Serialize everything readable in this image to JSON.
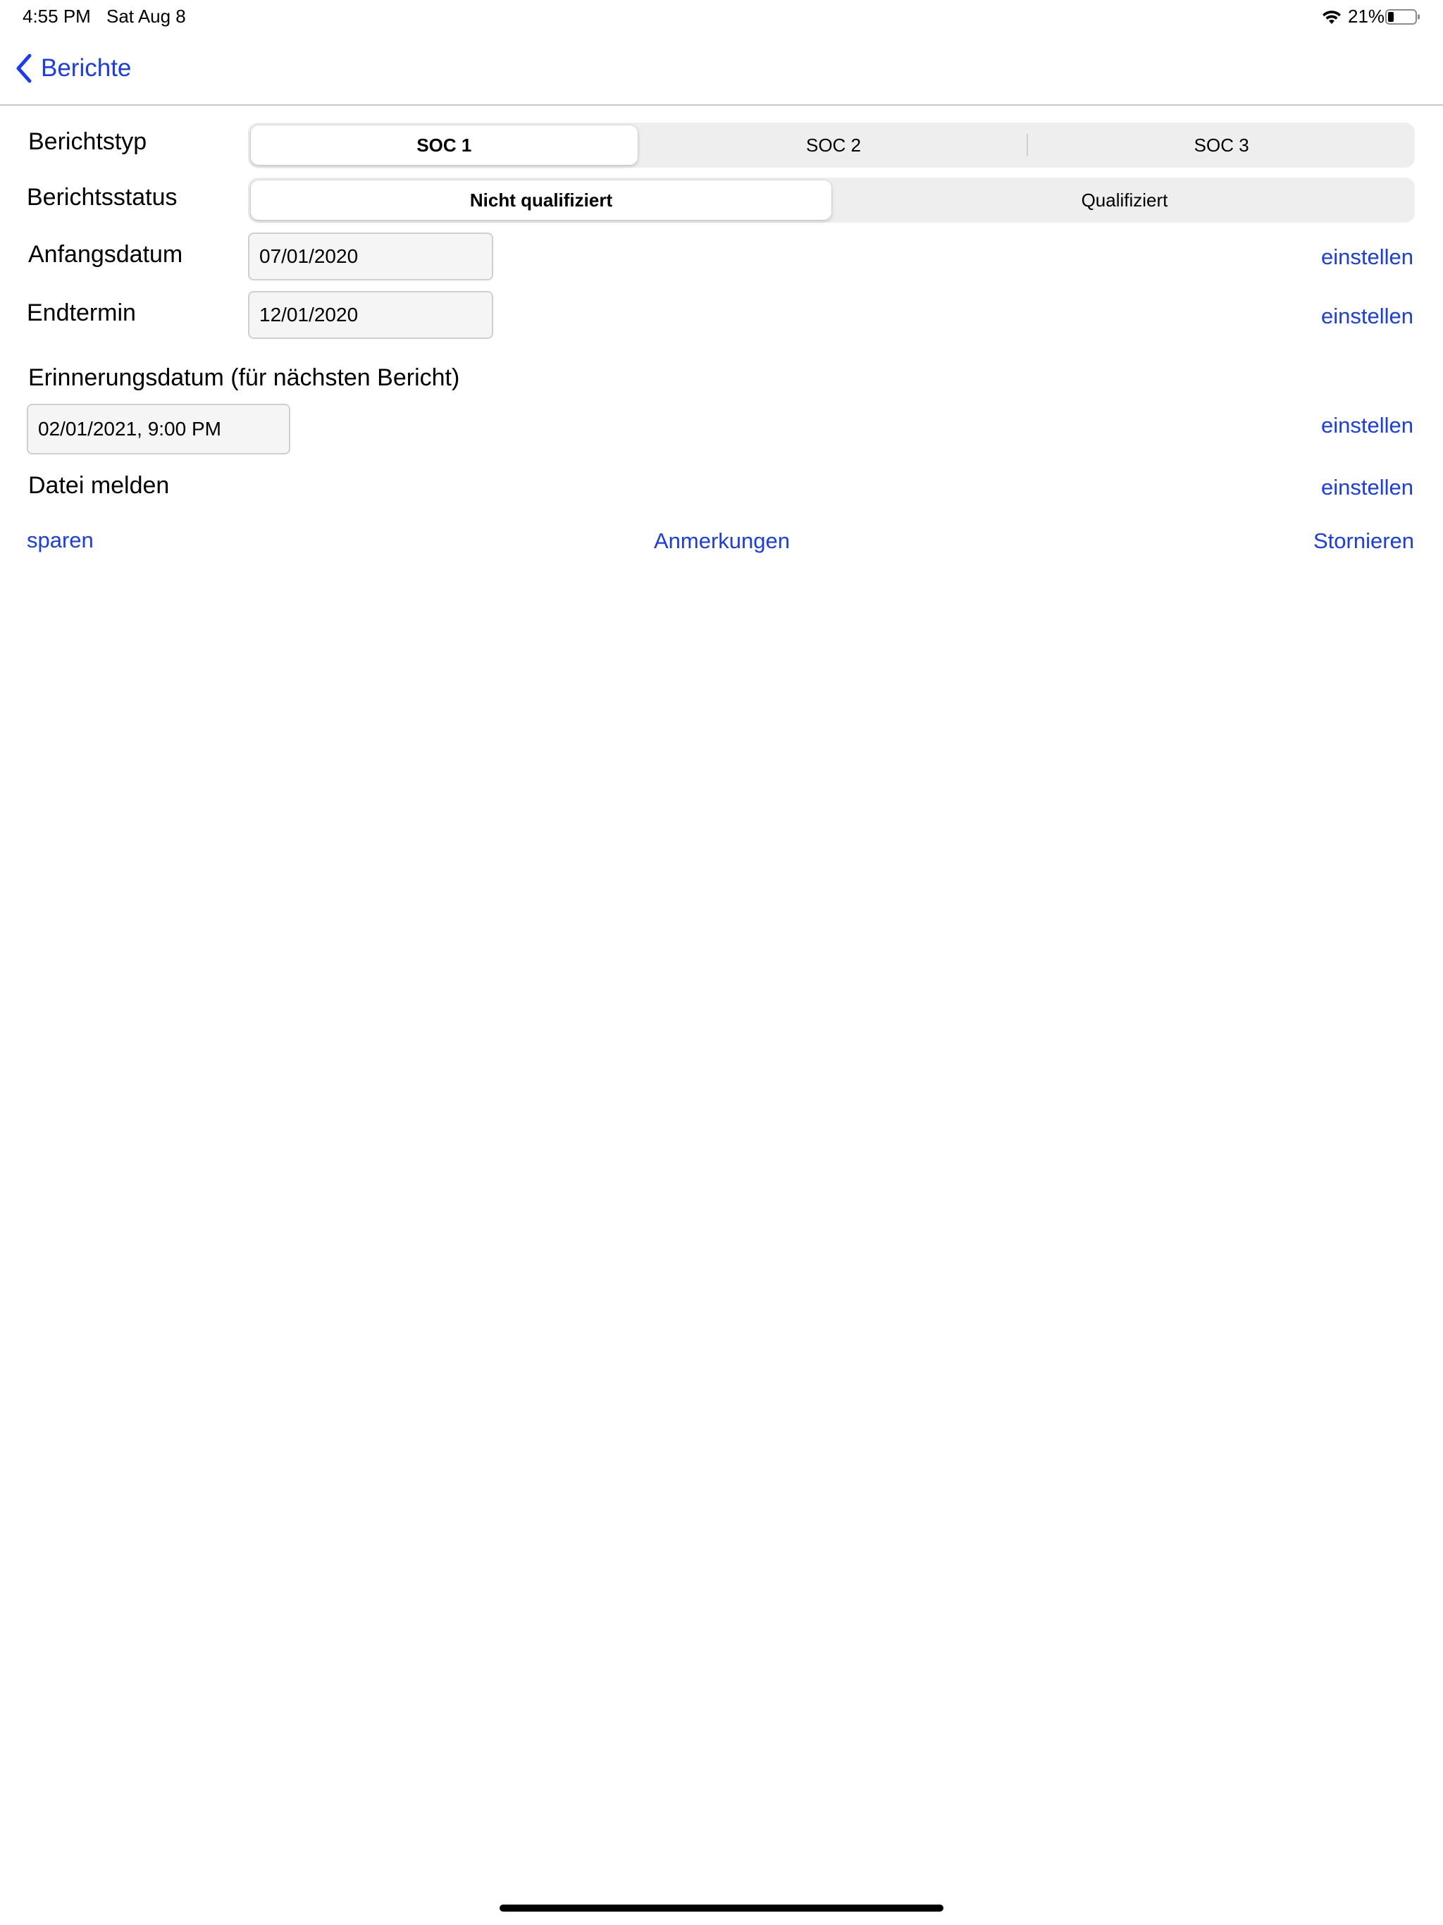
{
  "status_bar": {
    "time": "4:55 PM",
    "date": "Sat Aug 8",
    "battery_percent": "21%",
    "battery_level": 0.21,
    "wifi_icon": "wifi-icon",
    "battery_icon": "battery-icon"
  },
  "nav": {
    "back_label": "Berichte",
    "back_icon": "chevron-left-icon"
  },
  "form": {
    "report_type": {
      "label": "Berichtstyp",
      "options": [
        "SOC 1",
        "SOC 2",
        "SOC 3"
      ],
      "selected": "SOC 1"
    },
    "report_status": {
      "label": "Berichtsstatus",
      "options": [
        "Nicht qualifiziert",
        "Qualifiziert"
      ],
      "selected": "Nicht qualifiziert"
    },
    "start_date": {
      "label": "Anfangsdatum",
      "value": "07/01/2020",
      "action": "einstellen"
    },
    "end_date": {
      "label": "Endtermin",
      "value": "12/01/2020",
      "action": "einstellen"
    },
    "reminder": {
      "label": "Erinnerungsdatum (für nächsten Bericht)",
      "value": "02/01/2021, 9:00 PM",
      "action": "einstellen"
    },
    "report_file": {
      "label": "Datei melden",
      "action": "einstellen"
    }
  },
  "actions": {
    "save": "sparen",
    "notes": "Anmerkungen",
    "cancel": "Stornieren"
  },
  "colors": {
    "accent": "#1a3cf0",
    "segment_bg": "#eeeeef",
    "field_bg": "#f5f5f5"
  }
}
